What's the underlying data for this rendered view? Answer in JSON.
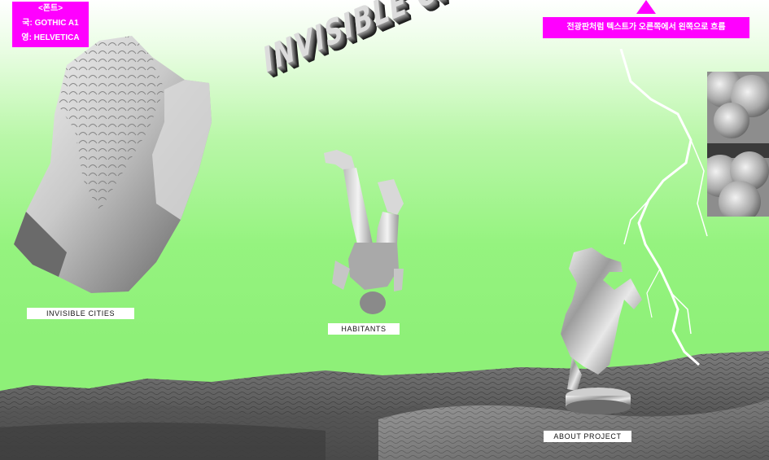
{
  "font_note": {
    "heading": "<폰트>",
    "korean": "국: GOTHIC A1",
    "english": "영: HELVETICA"
  },
  "marquee_note": {
    "text": "전광판처럼 텍스트가 오른쪽에서 왼쪽으로 흐름"
  },
  "title": "INVISIBLE CITIES",
  "nav": {
    "invisible_cities": "INVISIBLE CITIES",
    "habitants": "HABITANTS",
    "about_project": "ABOUT PROJECT"
  },
  "colors": {
    "accent": "#ff00ff",
    "background_top": "#ffffff",
    "background_bottom": "#8ef078"
  },
  "icons": {
    "marquee_arrow": "up-triangle-icon"
  }
}
